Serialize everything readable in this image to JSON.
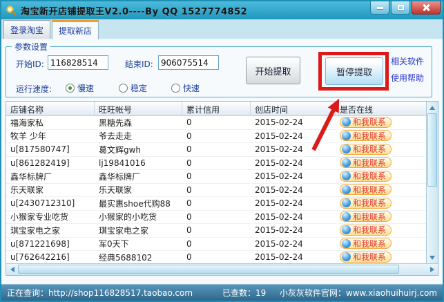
{
  "window": {
    "title": "淘宝新开店铺提取王V2.0----By QQ 1527774852"
  },
  "tabs": {
    "login": "登录淘宝",
    "extract": "提取新店"
  },
  "params": {
    "group_title": "参数设置",
    "start_id_label": "开始ID:",
    "start_id_value": "116828514",
    "end_id_label": "结束ID:",
    "end_id_value": "906075514",
    "speed_label": "运行速度:",
    "speed_options": [
      {
        "label": "慢速",
        "selected": true
      },
      {
        "label": "稳定",
        "selected": false
      },
      {
        "label": "快速",
        "selected": false
      }
    ],
    "start_button": "开始提取",
    "pause_button": "暂停提取",
    "link_related": "相关软件",
    "link_help": "使用帮助"
  },
  "table": {
    "columns": [
      "店铺名称",
      "旺旺帐号",
      "累计信用",
      "创店时间",
      "是否在线"
    ],
    "contact_label": "和我联系",
    "rows": [
      {
        "shop": "福海家私",
        "wangwang": "黑糖先森",
        "credit": "0",
        "created": "2015-02-24"
      },
      {
        "shop": "牧羊 少年",
        "wangwang": "爷去走走",
        "credit": "0",
        "created": "2015-02-24"
      },
      {
        "shop": "u[817580747]",
        "wangwang": "葛文辉gwh",
        "credit": "0",
        "created": "2015-02-24"
      },
      {
        "shop": "u[861282419]",
        "wangwang": "lj19841016",
        "credit": "0",
        "created": "2015-02-24"
      },
      {
        "shop": "鑫华标牌厂",
        "wangwang": "鑫华标牌厂",
        "credit": "0",
        "created": "2015-02-24"
      },
      {
        "shop": "乐天联家",
        "wangwang": "乐天联家",
        "credit": "0",
        "created": "2015-02-24"
      },
      {
        "shop": "u[2430712310]",
        "wangwang": "最实惠shoe代购88",
        "credit": "0",
        "created": "2015-02-24"
      },
      {
        "shop": "小猴家专业吃货",
        "wangwang": "小猴家的小吃货",
        "credit": "0",
        "created": "2015-02-24"
      },
      {
        "shop": "琪宝家电之家",
        "wangwang": "琪宝家电之家",
        "credit": "0",
        "created": "2015-02-24"
      },
      {
        "shop": "u[871221698]",
        "wangwang": "军0天下",
        "credit": "0",
        "created": "2015-02-24"
      },
      {
        "shop": "u[762642216]",
        "wangwang": "经典5688102",
        "credit": "0",
        "created": "2015-02-24"
      }
    ]
  },
  "statusbar": {
    "querying": "正在查询：http://shop116828517.taobao.com",
    "count": "已查数：19",
    "website": "小灰灰软件官网：www.xiaohuihuirj.com"
  },
  "icons": {
    "app": "magnifier-icon",
    "minimize": "minimize-icon",
    "maximize": "maximize-icon",
    "close": "close-icon",
    "online_status": "wangwang-icon",
    "annotation": "red-arrow-icon"
  },
  "colors": {
    "titlebar": "#2aa5c9",
    "close_button": "#c2332e",
    "tab_active_accent": "#f49a2b",
    "label_navy": "#1b3f9e",
    "link_blue": "#2a35cc",
    "annotation_red": "#dc1a1a",
    "contact_text_red": "#e0372a",
    "contact_bg_yellow": "#ffe092",
    "contact_border_orange": "#f2a93e",
    "statusbar_blue": "#3b80a8",
    "radio_selected_green": "#2f9a32"
  }
}
